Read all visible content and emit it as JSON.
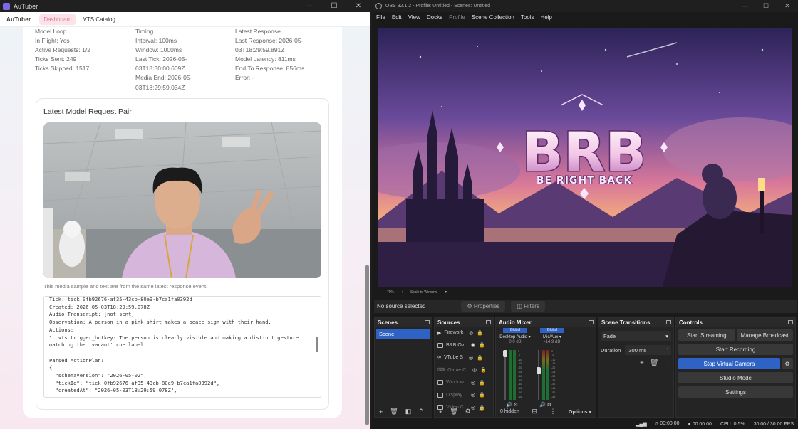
{
  "autuber": {
    "window_title": "AuTuber",
    "nav": {
      "brand": "AuTuber",
      "tabs": [
        "Dashboard",
        "VTS Catalog"
      ]
    },
    "model_loop": {
      "heading": "Model Loop",
      "in_flight": "In Flight: Yes",
      "active_requests": "Active Requests: 1/2",
      "ticks_sent": "Ticks Sent: 249",
      "ticks_skipped": "Ticks Skipped: 1517"
    },
    "timing": {
      "heading": "Timing",
      "interval": "Interval: 100ms",
      "window": "Window: 1000ms",
      "last_tick_1": "Last Tick: 2026-05-",
      "last_tick_2": "03T18:30:00.609Z",
      "media_end_1": "Media End: 2026-05-",
      "media_end_2": "03T18:29:59.034Z"
    },
    "latest_response": {
      "heading": "Latest Response",
      "last_response_1": "Last Response: 2026-05-",
      "last_response_2": "03T18:29:59.891Z",
      "model_latency": "Model Latency: 811ms",
      "end_to_response": "End To Response: 856ms",
      "error": "Error: -"
    },
    "pair": {
      "title": "Latest Model Request Pair",
      "caption": "This media sample and text are from the same latest response event.",
      "log_lines": [
        "Tick: tick_0fb92676-af35-43cb-80e9-b7ca1fa0392d",
        "Created: 2026-05-03T18:29:59.078Z",
        "Audio Transcript: [not sent]",
        "Observation: A person in a pink shirt makes a peace sign with their hand.",
        "Actions:",
        "1. vts.trigger_hotkey: The person is clearly visible and making a distinct gesture",
        "matching the 'vacant' cue label.",
        "",
        "Parsed ActionPlan:",
        "{",
        "  \"schemaVersion\": \"2026-05-02\",",
        "  \"tickId\": \"tick_0fb92676-af35-43cb-80e9-b7ca1fa0392d\",",
        "  \"createdAt\": \"2026-05-03T18:29:59.078Z\","
      ]
    }
  },
  "obs": {
    "window_title": "OBS 32.1.2 - Profile: Untitled - Scenes: Untitled",
    "menu": [
      "File",
      "Edit",
      "View",
      "Docks",
      "Profile",
      "Scene Collection",
      "Tools",
      "Help"
    ],
    "preview": {
      "title": "BRB",
      "subtitle": "BE RIGHT BACK"
    },
    "zoom": {
      "level": "70%",
      "mode": "Scale to Window"
    },
    "source_bar": {
      "status": "No source selected",
      "properties": "Properties",
      "filters": "Filters"
    },
    "scenes": {
      "title": "Scenes",
      "items": [
        "Scene"
      ]
    },
    "sources": {
      "title": "Sources",
      "items": [
        "Firework",
        "BRB Ov",
        "VTube S",
        "Game C",
        "Window",
        "Display",
        "Video C"
      ]
    },
    "mixer": {
      "title": "Audio Mixer",
      "channels": [
        {
          "badge": "Global",
          "name": "Desktop Audio",
          "db": "0.0 dB"
        },
        {
          "badge": "Global",
          "name": "Mic/Aux",
          "db": "-14.9 dB"
        }
      ],
      "scale": [
        "0",
        "-5",
        "-10",
        "-15",
        "-20",
        "-25",
        "-30",
        "-35",
        "-40",
        "-45",
        "-50",
        "-55",
        "-60"
      ],
      "hidden": "0 hidden",
      "options": "Options"
    },
    "transitions": {
      "title": "Scene Transitions",
      "type": "Fade",
      "duration_label": "Duration",
      "duration": "300 ms"
    },
    "controls": {
      "title": "Controls",
      "start_streaming": "Start Streaming",
      "manage_broadcast": "Manage Broadcast",
      "start_recording": "Start Recording",
      "stop_virtual_camera": "Stop Virtual Camera",
      "studio_mode": "Studio Mode",
      "settings": "Settings"
    },
    "status": {
      "stream_time": "00:00:00",
      "rec_time": "00:00:00",
      "cpu": "CPU: 0.5%",
      "fps": "30.00 / 30.00 FPS"
    },
    "colors": {
      "accent": "#2e63c5",
      "background": "#1a1a1a"
    }
  }
}
